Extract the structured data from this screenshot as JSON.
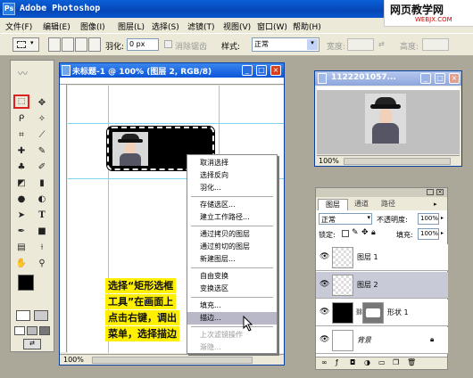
{
  "app": {
    "title": "Adobe Photoshop",
    "icon": "photoshop-icon"
  },
  "watermark": {
    "line1": "网页教学网",
    "line2": "WEBJX.COM"
  },
  "menubar": {
    "items": [
      "文件(F)",
      "编辑(E)",
      "图像(I)",
      "图层(L)",
      "选择(S)",
      "滤镜(T)",
      "视图(V)",
      "窗口(W)",
      "帮助(H)"
    ]
  },
  "options": {
    "feather_label": "羽化:",
    "feather_value": "0 px",
    "antialias_label": "消除锯齿",
    "style_label": "样式:",
    "style_value": "正常",
    "width_label": "宽度:",
    "height_label": "高度:"
  },
  "doc": {
    "title": "未标题-1 @ 100% (图层 2, RGB/8)",
    "zoom": "100%"
  },
  "navigator": {
    "title": "1122201057...",
    "zoom": "100%"
  },
  "context_menu": {
    "items": [
      {
        "label": "取消选择",
        "enabled": true
      },
      {
        "label": "选择反向",
        "enabled": true
      },
      {
        "label": "羽化...",
        "enabled": true
      },
      {
        "label": "存储选区...",
        "enabled": true
      },
      {
        "label": "建立工作路径...",
        "enabled": true
      },
      {
        "label": "通过拷贝的图层",
        "enabled": true
      },
      {
        "label": "通过剪切的图层",
        "enabled": true
      },
      {
        "label": "新建图层...",
        "enabled": true
      },
      {
        "label": "自由变换",
        "enabled": true
      },
      {
        "label": "变换选区",
        "enabled": true
      },
      {
        "label": "填充...",
        "enabled": true
      },
      {
        "label": "描边...",
        "enabled": true,
        "selected": true
      },
      {
        "label": "上次滤镜操作",
        "enabled": false
      },
      {
        "label": "渐隐...",
        "enabled": false
      }
    ]
  },
  "instruction": {
    "lines": [
      "选择“矩形选框",
      "工具”在画面上",
      "点击右键，调出",
      "菜单，选择描边"
    ]
  },
  "layers": {
    "tabs": [
      "图层",
      "通道",
      "路径"
    ],
    "blend": "正常",
    "opacity_label": "不透明度:",
    "opacity_value": "100%",
    "lock_label": "锁定:",
    "fill_label": "填充:",
    "fill_value": "100%",
    "rows": [
      {
        "name": "图层 1",
        "active": false
      },
      {
        "name": "图层 2",
        "active": true
      },
      {
        "name": "形状 1",
        "active": false
      },
      {
        "name": "背景",
        "active": false
      }
    ]
  },
  "colors": {
    "accent": "#0a55d8",
    "highlight": "#fff000",
    "tool_highlight": "#e02020"
  }
}
